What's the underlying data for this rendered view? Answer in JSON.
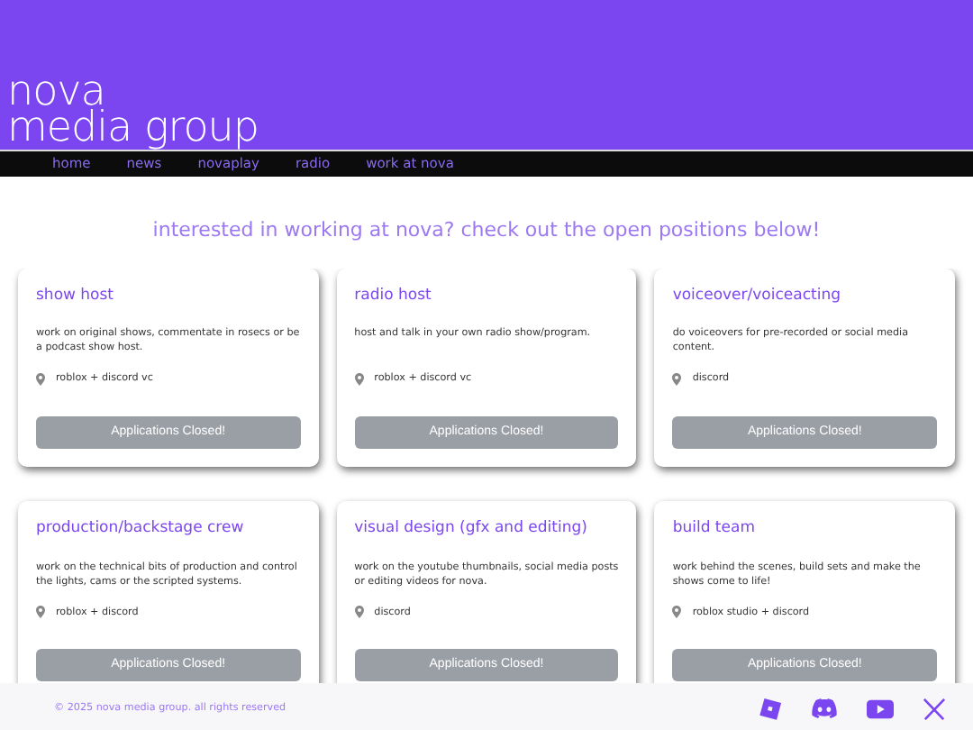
{
  "header": {
    "logo_lines": [
      "nova",
      "media group"
    ]
  },
  "nav": [
    "home",
    "news",
    "novaplay",
    "radio",
    "work at nova"
  ],
  "heading": "interested in working at nova? check out the open positions below!",
  "positions": [
    {
      "title": "show host",
      "description": "work on original shows, commentate in rosecs or be a podcast show host.",
      "location": "roblox + discord vc",
      "button": "Applications Closed!",
      "disabled": true
    },
    {
      "title": "radio host",
      "description": "host and talk in your own radio show/program.",
      "location": "roblox + discord vc",
      "button": "Applications Closed!",
      "disabled": true
    },
    {
      "title": "voiceover/voiceacting",
      "description": "do voiceovers for pre-recorded or social media content.",
      "location": "discord",
      "button": "Applications Closed!",
      "disabled": true
    },
    {
      "title": "production/backstage crew",
      "description": "work on the technical bits of production and control the lights, cams or the scripted systems.",
      "location": "roblox + discord",
      "button": "Applications Closed!",
      "disabled": true
    },
    {
      "title": "visual design (gfx and editing)",
      "description": "work on the youtube thumbnails, social media posts or editing videos for nova.",
      "location": "discord",
      "button": "Applications Closed!",
      "disabled": true
    },
    {
      "title": "build team",
      "description": "work behind the scenes, build sets and make the shows come to life!",
      "location": "roblox studio + discord",
      "button": "Applications Closed!",
      "disabled": true
    }
  ],
  "footer": {
    "copyright": "© 2025 nova media group. all rights reserved",
    "social": [
      {
        "kind": "roblox"
      },
      {
        "kind": "discord"
      },
      {
        "kind": "youtube"
      },
      {
        "kind": "x"
      }
    ]
  }
}
